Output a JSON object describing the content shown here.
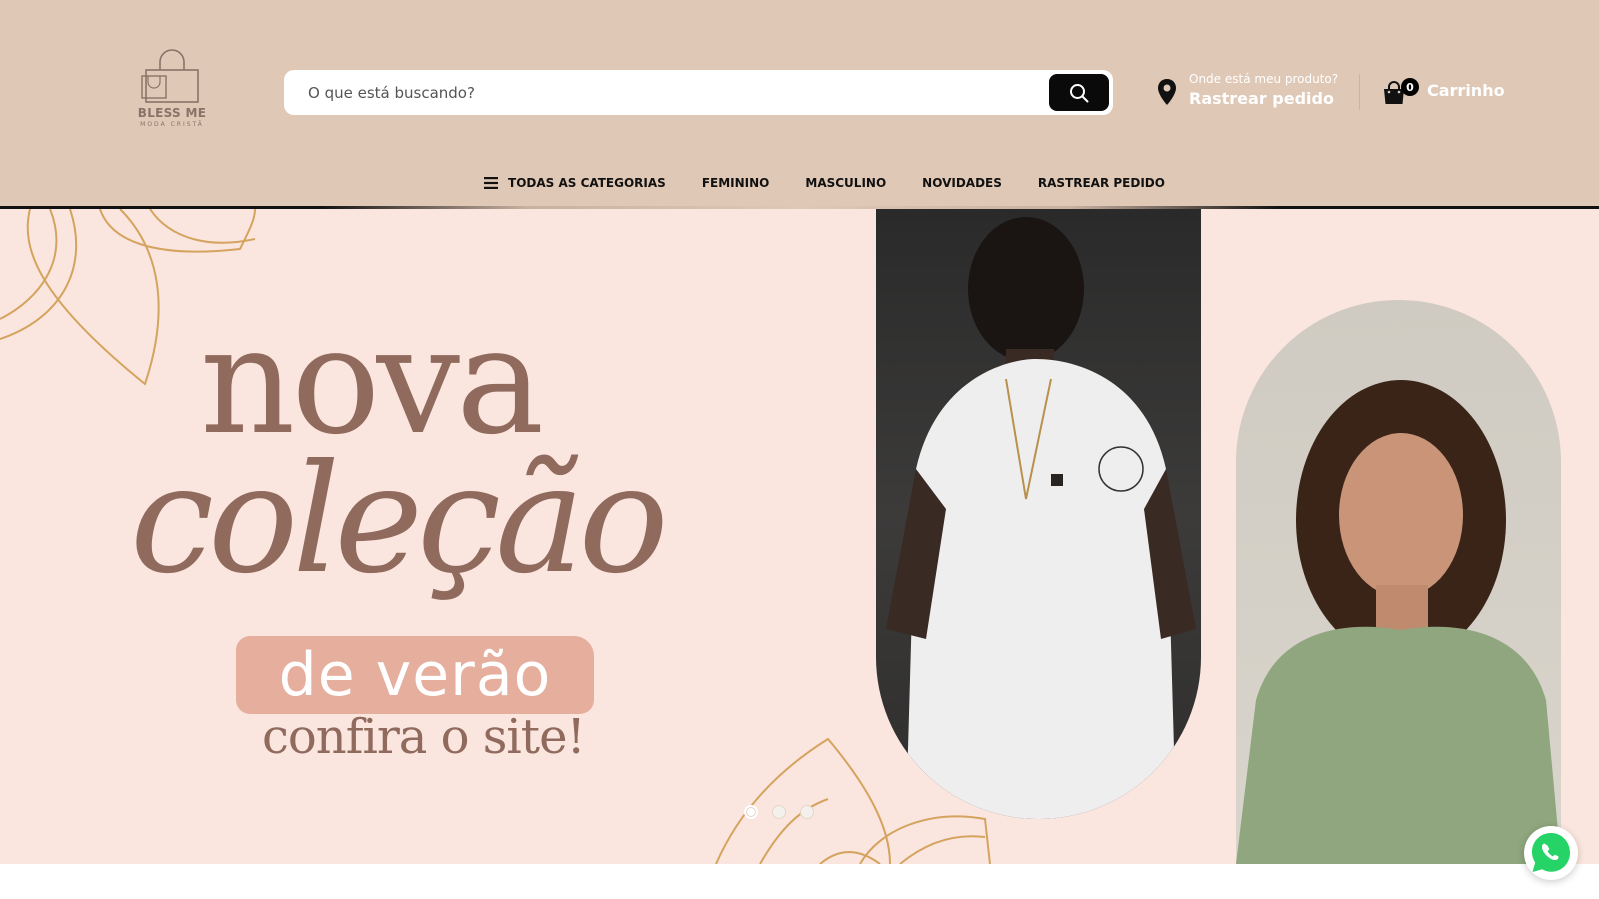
{
  "brand": {
    "name": "BLESS ME",
    "tagline": "MODA CRISTÃ"
  },
  "search": {
    "placeholder": "O que está buscando?",
    "value": ""
  },
  "tracking": {
    "question": "Onde está meu produto?",
    "label": "Rastrear pedido"
  },
  "cart": {
    "count": "0",
    "label": "Carrinho"
  },
  "nav": {
    "items": [
      {
        "label": "TODAS AS CATEGORIAS",
        "icon": "menu-icon"
      },
      {
        "label": "FEMININO"
      },
      {
        "label": "MASCULINO"
      },
      {
        "label": "NOVIDADES"
      },
      {
        "label": "RASTREAR PEDIDO"
      }
    ]
  },
  "banner": {
    "line1": "nova",
    "line2": "coleção",
    "line3": "de verão",
    "line4": "confira o site!",
    "slides": 3,
    "active_slide": 1
  },
  "colors": {
    "header_bg": "#e0c8b6",
    "banner_bg": "#fbe6df",
    "headline": "#8f6a5d",
    "pill": "#e5ae9d",
    "whatsapp": "#25d366"
  }
}
